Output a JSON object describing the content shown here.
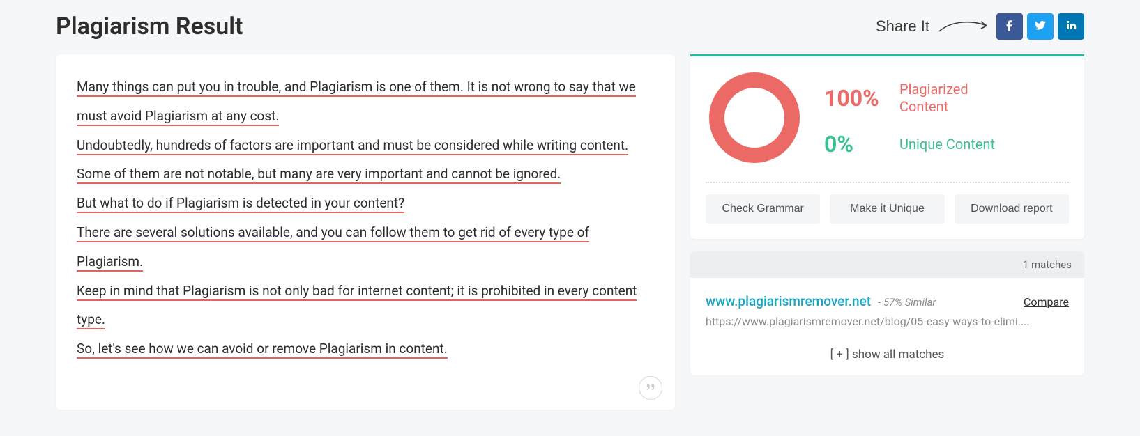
{
  "header": {
    "title": "Plagiarism Result",
    "share_label": "Share It"
  },
  "social": {
    "facebook": "facebook",
    "twitter": "twitter",
    "linkedin": "linkedin"
  },
  "content": {
    "sentences": [
      "Many things can put you in trouble, and Plagiarism is one of them. It is not wrong to say that we must avoid Plagiarism at any cost.",
      "Undoubtedly, hundreds of factors are important and must be considered while writing content.",
      "Some of them are not notable, but many are very important and cannot be ignored.",
      "But what to do if Plagiarism is detected in your content?",
      "There are several solutions available, and you can follow them to get rid of every type of Plagiarism.",
      "Keep in mind that Plagiarism is not only bad for internet content; it is prohibited in every content type.",
      "So, let's see how we can avoid or remove Plagiarism in content."
    ]
  },
  "stats": {
    "plagiarized_pct": "100%",
    "plagiarized_label": "Plagiarized Content",
    "unique_pct": "0%",
    "unique_label": "Unique Content",
    "colors": {
      "plag": "#ec6a66",
      "uniq": "#3cbf8f"
    }
  },
  "actions": {
    "check_grammar": "Check Grammar",
    "make_unique": "Make it Unique",
    "download_report": "Download report"
  },
  "matches": {
    "count_label": "1 matches",
    "items": [
      {
        "domain": "www.plagiarismremover.net",
        "similar": "- 57% Similar",
        "compare": "Compare",
        "url": "https://www.plagiarismremover.net/blog/05-easy-ways-to-elimi...."
      }
    ],
    "show_all": "[ + ] show all matches"
  },
  "chart_data": {
    "type": "pie",
    "title": "",
    "series": [
      {
        "name": "Plagiarized Content",
        "value": 100,
        "color": "#ec6a66"
      },
      {
        "name": "Unique Content",
        "value": 0,
        "color": "#3cbf8f"
      }
    ]
  }
}
